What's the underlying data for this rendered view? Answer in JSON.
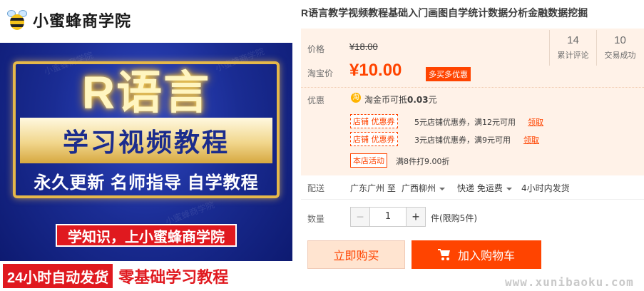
{
  "hero": {
    "logo_text": "小蜜蜂商学院",
    "watermark": "小蜜蜂商学院",
    "big_title": "R语言",
    "band_text": "学习视频教程",
    "slogan": "永久更新 名师指导 自学教程",
    "red_pill": "学知识，上小蜜蜂商学院",
    "bottom_left": "24小时自动发货",
    "bottom_right": "零基础学习教程"
  },
  "product": {
    "title": "R语言教学视频教程基础入门画图自学统计数据分析金融数据挖掘"
  },
  "price": {
    "label": "价格",
    "original": "¥18.00",
    "taobao_label": "淘宝价",
    "current": "¥10.00",
    "badge": "多买多优惠"
  },
  "stats": {
    "reviews_num": "14",
    "reviews_label": "累计评论",
    "deals_num": "10",
    "deals_label": "交易成功"
  },
  "discounts": {
    "label": "优惠",
    "coin_glyph": "淘",
    "coin_text_prefix": "淘金币可抵",
    "coin_amount": "0.03",
    "coin_suffix": "元",
    "coupons": [
      {
        "tag": "店铺 优惠券",
        "text": "5元店铺优惠券，满12元可用",
        "link": "领取"
      },
      {
        "tag": "店铺 优惠券",
        "text": "3元店铺优惠券，满9元可用",
        "link": "领取"
      }
    ],
    "activity_tag": "本店活动",
    "activity_text": "满8件打9.00折"
  },
  "shipping": {
    "label": "配送",
    "from": "广东广州 至",
    "to": "广西柳州",
    "method": "快递 免运费",
    "time": "4小时内发货"
  },
  "quantity": {
    "label": "数量",
    "minus": "−",
    "value": "1",
    "plus": "+",
    "limit": "件(限购5件)"
  },
  "actions": {
    "buy_now": "立即购买",
    "add_to_cart": "加入购物车"
  },
  "site_watermark": "www.xunibaoku.com",
  "colors": {
    "accent": "#ff4400",
    "promo_bg": "#fff2e8",
    "hero_blue": "#1a2c93"
  }
}
